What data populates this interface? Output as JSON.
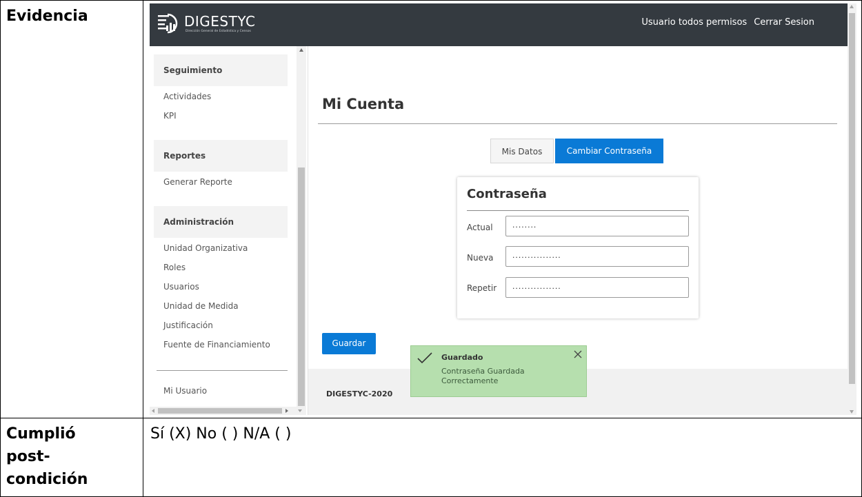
{
  "doc": {
    "evidence_label": "Evidencia",
    "postcondition_label": [
      "Cumplió",
      "post-",
      "condición"
    ],
    "postcondition_value": "Sí (X) No ( )  N/A ( )"
  },
  "app": {
    "logo_text": "DIGESTYC",
    "logo_subtext": "Dirección General de Estadística y Censos",
    "user_link": "Usuario todos permisos",
    "logout_link": "Cerrar Sesion"
  },
  "sidebar": {
    "sections": [
      {
        "title": "Seguimiento",
        "items": [
          "Actividades",
          "KPI"
        ]
      },
      {
        "title": "Reportes",
        "items": [
          "Generar Reporte"
        ]
      },
      {
        "title": "Administración",
        "items": [
          "Unidad Organizativa",
          "Roles",
          "Usuarios",
          "Unidad de Medida",
          "Justificación",
          "Fuente de Financiamiento"
        ]
      }
    ],
    "bottom_item": "Mi Usuario"
  },
  "main": {
    "page_title": "Mi Cuenta",
    "tabs": [
      {
        "label": "Mis Datos",
        "active": false
      },
      {
        "label": "Cambiar Contraseña",
        "active": true
      }
    ],
    "card": {
      "title": "Contraseña",
      "fields": [
        {
          "label": "Actual",
          "value": "........"
        },
        {
          "label": "Nueva",
          "value": "................"
        },
        {
          "label": "Repetir",
          "value": "................"
        }
      ]
    },
    "save_button": "Guardar",
    "footer_text": "DIGESTYC-2020"
  },
  "toast": {
    "title": "Guardado",
    "message": "Contraseña Guardada Correctamente"
  },
  "colors": {
    "topbar": "#343a40",
    "primary": "#0a7ad6",
    "toast_bg": "#b6dfae",
    "footer_bg": "#f1f1f1"
  },
  "icons": [
    "logo-icon",
    "check-icon",
    "close-icon"
  ]
}
